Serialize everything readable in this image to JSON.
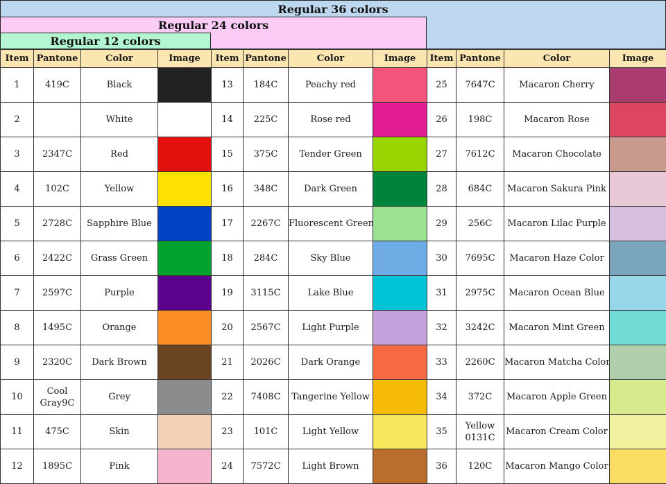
{
  "headers": {
    "regular36": "Regular 36 colors",
    "regular24": "Regular 24 colors",
    "regular12": "Regular 12 colors"
  },
  "columns": [
    "Item",
    "Pantone",
    "Color",
    "Image"
  ],
  "rows": [
    [
      {
        "item": "1",
        "pantone": "419C",
        "color": "Black",
        "swatch": "#222222"
      },
      {
        "item": "13",
        "pantone": "184C",
        "color": "Peachy red",
        "swatch": "#f2547a"
      },
      {
        "item": "25",
        "pantone": "7647C",
        "color": "Macaron Cherry",
        "swatch": "#a93b6e"
      }
    ],
    [
      {
        "item": "2",
        "pantone": "",
        "color": "White",
        "swatch": "#ffffff"
      },
      {
        "item": "14",
        "pantone": "225C",
        "color": "Rose red",
        "swatch": "#e21d94"
      },
      {
        "item": "26",
        "pantone": "198C",
        "color": "Macaron Rose",
        "swatch": "#dc4660"
      }
    ],
    [
      {
        "item": "3",
        "pantone": "2347C",
        "color": "Red",
        "swatch": "#e3110e"
      },
      {
        "item": "15",
        "pantone": "375C",
        "color": "Tender Green",
        "swatch": "#98d500"
      },
      {
        "item": "27",
        "pantone": "7612C",
        "color": "Macaron Chocolate",
        "swatch": "#c89a8e"
      }
    ],
    [
      {
        "item": "4",
        "pantone": "102C",
        "color": "Yellow",
        "swatch": "#fde100"
      },
      {
        "item": "16",
        "pantone": "348C",
        "color": "Dark Green",
        "swatch": "#00843c"
      },
      {
        "item": "28",
        "pantone": "684C",
        "color": "Macaron Sakura Pink",
        "swatch": "#e9c8d8"
      }
    ],
    [
      {
        "item": "5",
        "pantone": "2728C",
        "color": "Sapphire Blue",
        "swatch": "#0242c2"
      },
      {
        "item": "17",
        "pantone": "2267C",
        "color": "Fluorescent Green",
        "swatch": "#9be293"
      },
      {
        "item": "29",
        "pantone": "256C",
        "color": "Macaron Lilac Purple",
        "swatch": "#d7bfdf"
      }
    ],
    [
      {
        "item": "6",
        "pantone": "2422C",
        "color": "Grass Green",
        "swatch": "#02a32f"
      },
      {
        "item": "18",
        "pantone": "284C",
        "color": "Sky Blue",
        "swatch": "#6fabe4"
      },
      {
        "item": "30",
        "pantone": "7695C",
        "color": "Macaron Haze Color",
        "swatch": "#7aa5bd"
      }
    ],
    [
      {
        "item": "7",
        "pantone": "2597C",
        "color": "Purple",
        "swatch": "#5c008e"
      },
      {
        "item": "19",
        "pantone": "3115C",
        "color": "Lake Blue",
        "swatch": "#00c3d8"
      },
      {
        "item": "31",
        "pantone": "2975C",
        "color": "Macaron Ocean Blue",
        "swatch": "#98d6ea"
      }
    ],
    [
      {
        "item": "8",
        "pantone": "1495C",
        "color": "Orange",
        "swatch": "#fe8c24"
      },
      {
        "item": "20",
        "pantone": "2567C",
        "color": "Light Purple",
        "swatch": "#c3a1dd"
      },
      {
        "item": "32",
        "pantone": "3242C",
        "color": "Macaron Mint Green",
        "swatch": "#70dbd4"
      }
    ],
    [
      {
        "item": "9",
        "pantone": "2320C",
        "color": "Dark Brown",
        "swatch": "#6b4523"
      },
      {
        "item": "21",
        "pantone": "2026C",
        "color": "Dark Orange",
        "swatch": "#f56a42"
      },
      {
        "item": "33",
        "pantone": "2260C",
        "color": "Macaron Matcha Color",
        "swatch": "#b1cfaa"
      }
    ],
    [
      {
        "item": "10",
        "pantone": "Cool Gray9C",
        "color": "Grey",
        "swatch": "#898b8c"
      },
      {
        "item": "22",
        "pantone": "7408C",
        "color": "Tangerine Yellow",
        "swatch": "#f6bb07"
      },
      {
        "item": "34",
        "pantone": "372C",
        "color": "Macaron Apple Green",
        "swatch": "#d5eb8d"
      }
    ],
    [
      {
        "item": "11",
        "pantone": "475C",
        "color": "Skin",
        "swatch": "#f3d1b5"
      },
      {
        "item": "23",
        "pantone": "101C",
        "color": "Light Yellow",
        "swatch": "#f6e75d"
      },
      {
        "item": "35",
        "pantone": "Yellow 0131C",
        "color": "Macaron Cream Color",
        "swatch": "#f1f2a0"
      }
    ],
    [
      {
        "item": "12",
        "pantone": "1895C",
        "color": "Pink",
        "swatch": "#f5b5d0"
      },
      {
        "item": "24",
        "pantone": "7572C",
        "color": "Light Brown",
        "swatch": "#b86f2e"
      },
      {
        "item": "36",
        "pantone": "120C",
        "color": "Macaron Mango Color",
        "swatch": "#fade63"
      }
    ]
  ]
}
